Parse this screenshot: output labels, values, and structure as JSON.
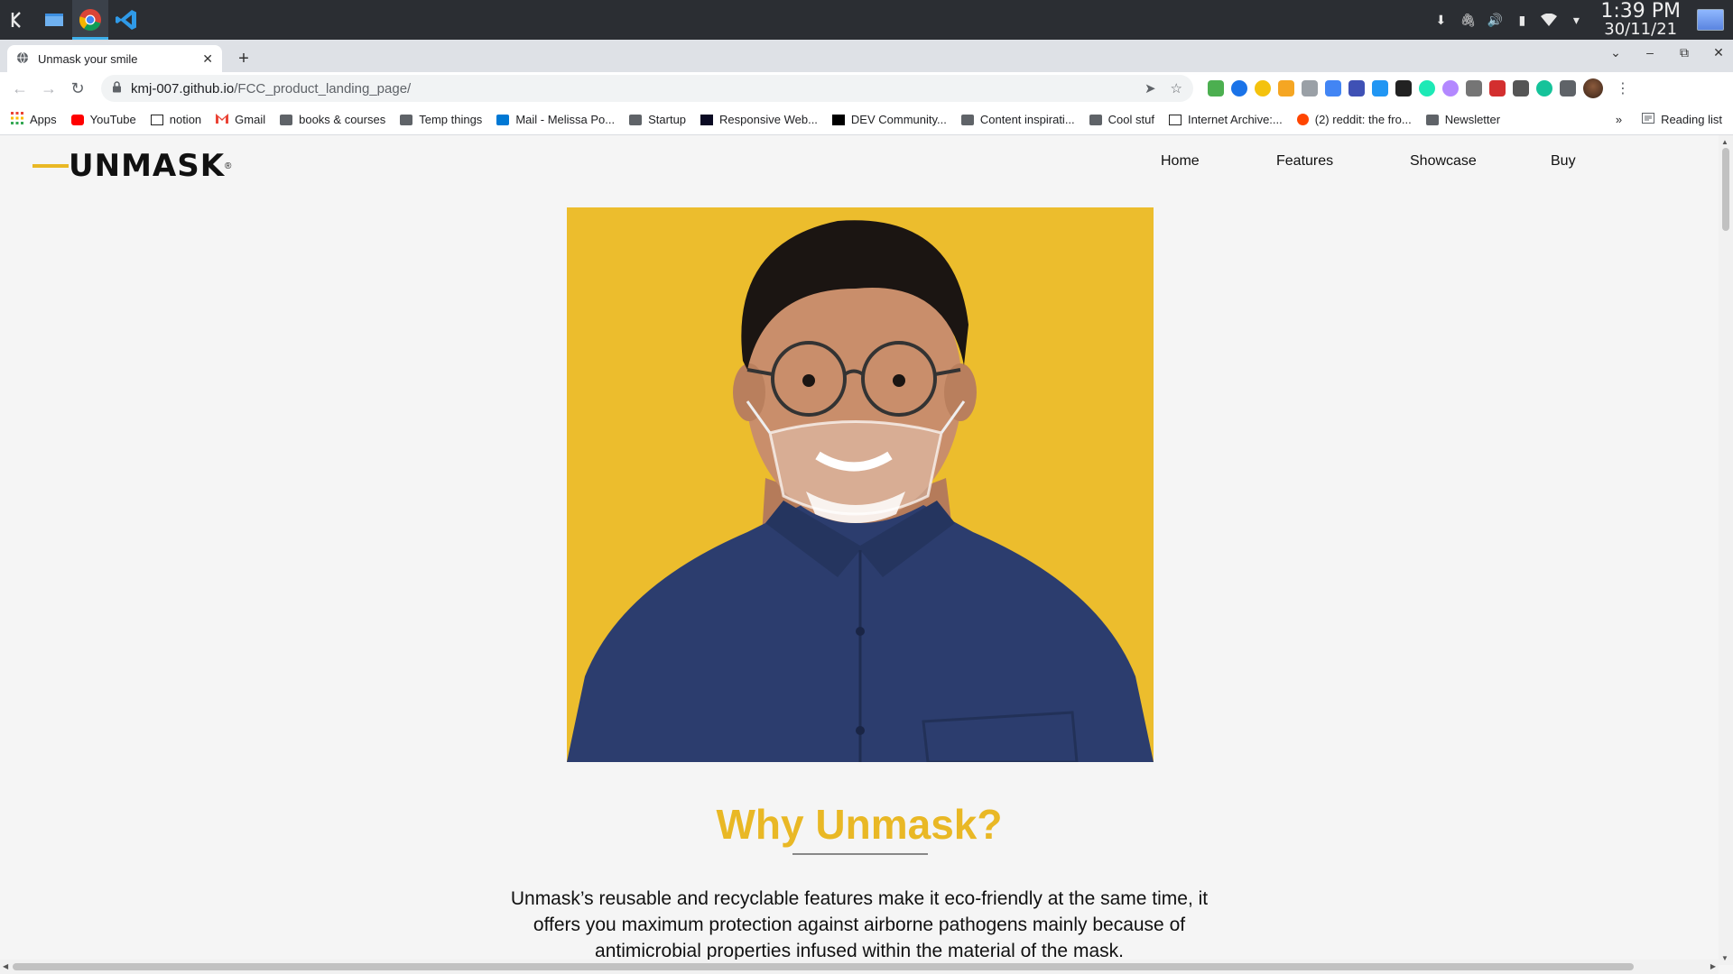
{
  "taskbar": {
    "apps": [
      "kde-menu-icon",
      "files-icon",
      "chrome-icon",
      "vscode-icon"
    ],
    "clock_time": "1:39 PM",
    "clock_date": "30/11/21"
  },
  "browser": {
    "tab_title": "Unmask your smile",
    "url_host": "kmj-007.github.io",
    "url_path": "/FCC_product_landing_page/",
    "bookmarks": [
      "Apps",
      "YouTube",
      "notion",
      "Gmail",
      "books & courses",
      "Temp things",
      "Mail - Melissa Po...",
      "Startup",
      "Responsive Web...",
      "DEV Community...",
      "Content inspirati...",
      "Cool stuf",
      "Internet Archive:...",
      "(2) reddit: the fro...",
      "Newsletter"
    ],
    "more_bookmarks": "»",
    "reading_list": "Reading list"
  },
  "site": {
    "logo_text": "UNMASK",
    "logo_reg": "®",
    "nav": [
      "Home",
      "Features",
      "Showcase",
      "Buy"
    ],
    "why_title": "Why Unmask?",
    "why_text": "Unmask’s reusable and recyclable features make it eco-friendly at the same time, it offers you maximum protection against airborne pathogens mainly because of antimicrobial properties infused within the material of the mask."
  },
  "colors": {
    "accent": "#e9b825",
    "hero_bg": "#ecbd2d",
    "shirt": "#2c3d6e"
  }
}
